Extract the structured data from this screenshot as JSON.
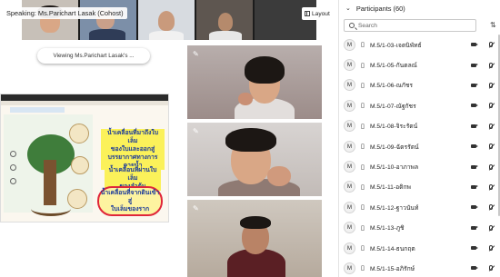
{
  "meeting": {
    "speaking_label": "Speaking: Ms.Parichart Lasak (Cohost)",
    "layout_label": "Layout",
    "viewing_label": "Viewing Ms.Parichart Lasak's ..."
  },
  "shared_slide": {
    "note_1": [
      "น้ำเคลื่อนที่มาถึงใบเล็ม",
      "ของใบและออกสู่",
      "บรรยากาศทางการคายน้ำ"
    ],
    "note_2": [
      "น้ำเคลื่อนที่ผ่านใบเล็ม",
      "ของลำต้น"
    ],
    "note_3": [
      "น้ำเคลื่อนที่จากดินเข้าสู่",
      "ใบเล็มของราก"
    ]
  },
  "participants_panel": {
    "title": "Participants (60)",
    "search_placeholder": "Search",
    "items": [
      {
        "avatar": "M",
        "name": "M.5/1-03-เจตนิพัทธ์",
        "device": "phone",
        "mic": "muted"
      },
      {
        "avatar": "M",
        "name": "M.5/1-05-กันตลณ์",
        "device": "phone",
        "mic": "muted"
      },
      {
        "avatar": "M",
        "name": "M.5/1-06-ณกัชร",
        "device": "phone",
        "mic": "muted"
      },
      {
        "avatar": "M",
        "name": "M.5/1-07-ณัฐกัชร",
        "device": "phone",
        "mic": "muted"
      },
      {
        "avatar": "M",
        "name": "M.5/1-08-จิระรัตน์",
        "device": "phone",
        "mic": "muted"
      },
      {
        "avatar": "M",
        "name": "M.5/1-09-ฉัตรรัตน์",
        "device": "phone",
        "mic": "muted"
      },
      {
        "avatar": "M",
        "name": "M.5/1-10-อาภาพล",
        "device": "phone",
        "mic": "muted"
      },
      {
        "avatar": "M",
        "name": "M.5/1-11-อติกพ",
        "device": "phone",
        "mic": "muted"
      },
      {
        "avatar": "M",
        "name": "M.5/1-12-ฐาวนันท์",
        "device": "phone",
        "mic": "muted"
      },
      {
        "avatar": "M",
        "name": "M.5/1-13-ภูชิ",
        "device": "phone",
        "mic": "muted"
      },
      {
        "avatar": "M",
        "name": "M.5/1-14-ธนกฤต",
        "device": "phone",
        "mic": "muted"
      },
      {
        "avatar": "M",
        "name": "M.5/1-15-อภิรักษ์",
        "device": "phone",
        "mic": "muted"
      }
    ]
  },
  "colors": {
    "note_text": "#1b3a9a",
    "highlight": "#fbf15a",
    "circle": "#e0263a"
  }
}
